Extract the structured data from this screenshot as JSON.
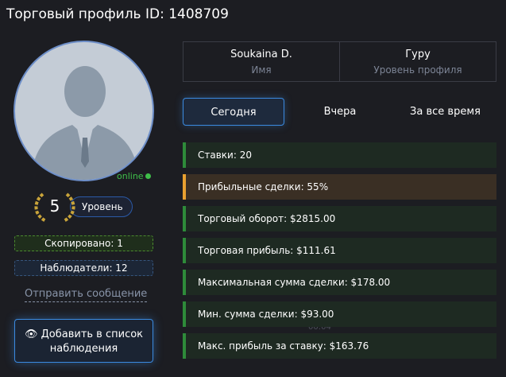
{
  "title": "Торговый профиль ID: 1408709",
  "profile": {
    "status": "online",
    "level": "5",
    "level_label": "Уровень",
    "copied": "Скопировано: 1",
    "watchers": "Наблюдатели: 12",
    "send_message": "Отправить сообщение",
    "add_watchlist": "Добавить в список наблюдения",
    "add_icon": "eye-icon"
  },
  "info": {
    "name": "Soukaina D.",
    "name_label": "Имя",
    "rank": "Гуру",
    "rank_label": "Уровень профиля"
  },
  "tabs": [
    "Сегодня",
    "Вчера",
    "За все время"
  ],
  "active_tab": "Сегодня",
  "stats": [
    "Ставки: 20",
    "Прибыльные сделки: 55%",
    "Торговый оборот: $2815.00",
    "Торговая прибыль: $111.61",
    "Максимальная сумма сделки: $178.00",
    "Мин. сумма сделки: $93.00",
    "Макс. прибыль за ставку: $163.76"
  ],
  "background_chart_time": "00:04",
  "colors": {
    "accent": "#3b8ae0",
    "positive": "#2e8b3a",
    "warning": "#e8a030",
    "online": "#3fbf4a"
  }
}
